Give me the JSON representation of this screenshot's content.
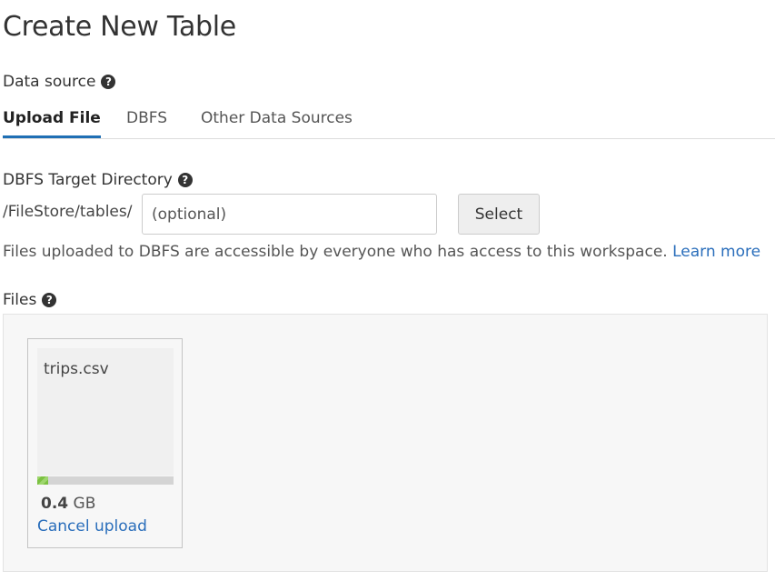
{
  "page": {
    "title": "Create New Table"
  },
  "data_source": {
    "label": "Data source",
    "help_icon": "question-circle-icon"
  },
  "tabs": [
    {
      "label": "Upload File",
      "active": true
    },
    {
      "label": "DBFS",
      "active": false
    },
    {
      "label": "Other Data Sources",
      "active": false
    }
  ],
  "target_directory": {
    "label": "DBFS Target Directory",
    "help_icon": "question-circle-icon",
    "prefix": "/FileStore/tables/",
    "placeholder": "(optional)",
    "value": "",
    "select_label": "Select"
  },
  "notice": {
    "text": "Files uploaded to DBFS are accessible by everyone who has access to this workspace.",
    "link_label": "Learn more"
  },
  "files": {
    "label": "Files",
    "help_icon": "question-circle-icon",
    "items": [
      {
        "name": "trips.csv",
        "size_value": "0.4",
        "size_unit": "GB",
        "progress_fraction": 0.08,
        "cancel_label": "Cancel upload"
      }
    ]
  },
  "colors": {
    "accent": "#1f6fb4",
    "link": "#2a6ebb",
    "progress": "#7cc142"
  }
}
